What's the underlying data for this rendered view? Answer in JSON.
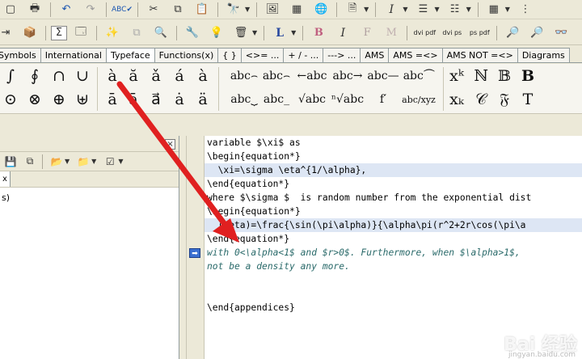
{
  "window": {
    "title": ""
  },
  "tabs": [
    "Symbols",
    "International",
    "Typeface",
    "Functions(x)",
    "{ }",
    "<>= ...",
    "+ / - ...",
    "---> ...",
    "AMS",
    "AMS =<>",
    "AMS NOT =<>",
    "Diagrams"
  ],
  "palette": {
    "row1": [
      "∫",
      "∮",
      "∩",
      "∪",
      "à",
      "ă",
      "ǎ",
      "á",
      "à"
    ],
    "row2": [
      "⊙",
      "⊗",
      "⊕",
      "⊎",
      "ā",
      "ā",
      "a⃗",
      "ȧ",
      "ä"
    ],
    "wide1": [
      "abc⌢",
      "abc⌢",
      "←abc",
      "abc→",
      "abc—",
      "abc⏜"
    ],
    "wide2": [
      "abc⏟",
      "abc_",
      "√abc",
      "ⁿ√abc",
      "f′",
      "abc/xyz"
    ],
    "right1": [
      "xᵏ",
      "ℕ",
      "𝔹",
      "B"
    ],
    "right2": [
      "xₖ",
      "𝒞",
      "𝔉",
      "T"
    ]
  },
  "toolbar2": {
    "L": "L",
    "B": "B",
    "I": "I",
    "F": "F",
    "M": "M",
    "dvi_pdf": "dvi pdf",
    "dvi_ps": "dvi ps",
    "ps_pdf": "ps pdf"
  },
  "editor": {
    "lines": [
      {
        "t": "variable $\\xi$ as",
        "hl": false
      },
      {
        "t": "\\begin{equation*}",
        "hl": false
      },
      {
        "t": "  \\xi=\\sigma \\eta^{1/\\alpha},",
        "hl": true
      },
      {
        "t": "\\end{equation*}",
        "hl": false
      },
      {
        "t": "where $\\sigma $  is random number from the exponential dist",
        "hl": false
      },
      {
        "t": "\\begin{equation*}",
        "hl": false
      },
      {
        "t": "  (\\eta)=\\frac{\\sin(\\pi\\alpha)}{\\alpha\\pi(r^2+2r\\cos(\\pi\\a",
        "hl": true
      },
      {
        "t": "\\end{equation*}",
        "hl": false
      },
      {
        "t": "with 0<\\alpha<1$ and $r>0$. Furthermore, when $\\alpha>1$, ",
        "hl": false
      },
      {
        "t": "not be a density any more.",
        "hl": false
      },
      {
        "t": "",
        "hl": false
      },
      {
        "t": "",
        "hl": false
      },
      {
        "t": "\\end{appendices}",
        "hl": false
      }
    ]
  },
  "left_panel": {
    "tab_label": "x",
    "body_text": "s)"
  },
  "watermark": {
    "main": "Bai 经验",
    "sub": "jingyan.baidu.com"
  }
}
